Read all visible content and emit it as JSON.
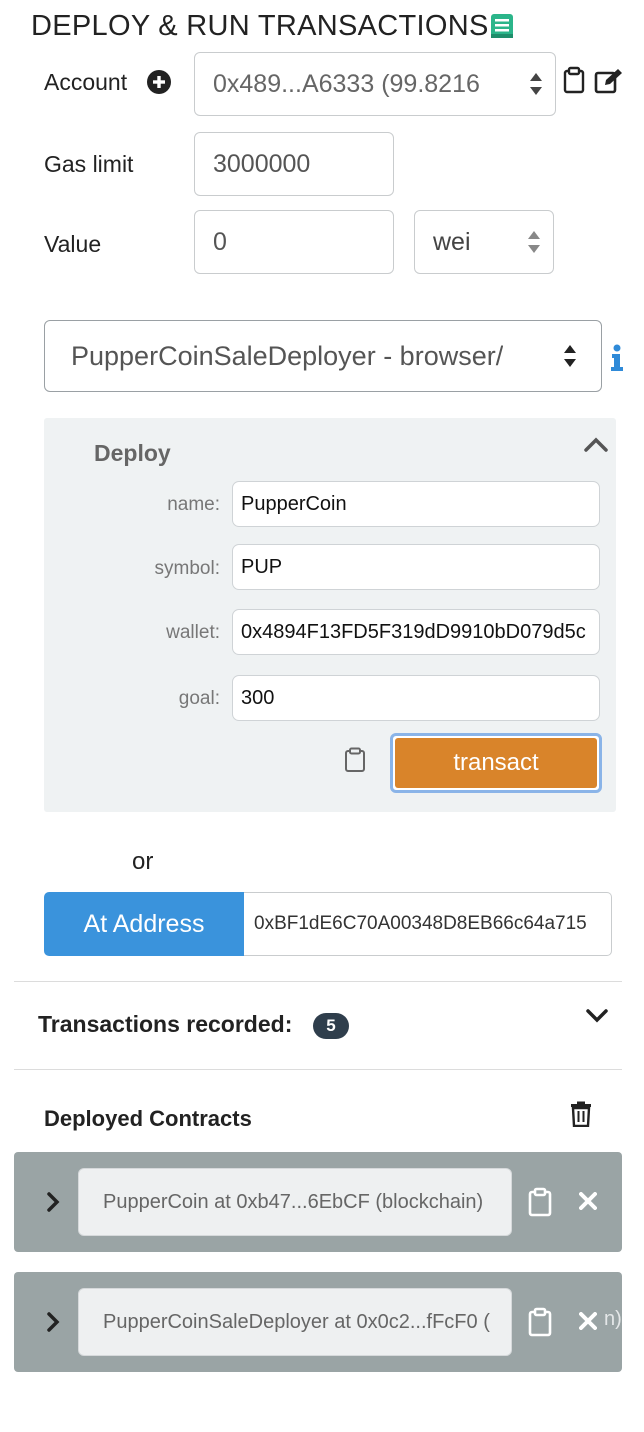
{
  "header": {
    "title": "DEPLOY & RUN TRANSACTIONS"
  },
  "account": {
    "label": "Account",
    "value": "0x489...A6333 (99.8216"
  },
  "gas_limit": {
    "label": "Gas limit",
    "value": "3000000"
  },
  "value": {
    "label": "Value",
    "amount": "0",
    "unit": "wei"
  },
  "contract_select": {
    "value": "PupperCoinSaleDeployer - browser/"
  },
  "deploy": {
    "title": "Deploy",
    "params": [
      {
        "label": "name:",
        "value": "PupperCoin"
      },
      {
        "label": "symbol:",
        "value": "PUP"
      },
      {
        "label": "wallet:",
        "value": "0x4894F13FD5F319dD9910bD079d5c"
      },
      {
        "label": "goal:",
        "value": "300"
      }
    ],
    "transact_label": "transact"
  },
  "or_label": "or",
  "at_address": {
    "button_label": "At Address",
    "value": "0xBF1dE6C70A00348D8EB66c64a715"
  },
  "transactions": {
    "label": "Transactions recorded:",
    "count": "5"
  },
  "deployed": {
    "title": "Deployed Contracts",
    "contracts": [
      {
        "name": "PupperCoin at 0xb47...6EbCF (blockchain)"
      },
      {
        "name": "PupperCoinSaleDeployer at 0x0c2...fFcF0 ("
      }
    ],
    "overflow_text": "n)"
  },
  "colors": {
    "transact": "#d9842a",
    "at_address": "#3a93dc",
    "panel_bg": "#eff2f3",
    "card_bg": "#9aa4a5",
    "badge": "#2f3e4c",
    "info": "#2f8ad8"
  }
}
